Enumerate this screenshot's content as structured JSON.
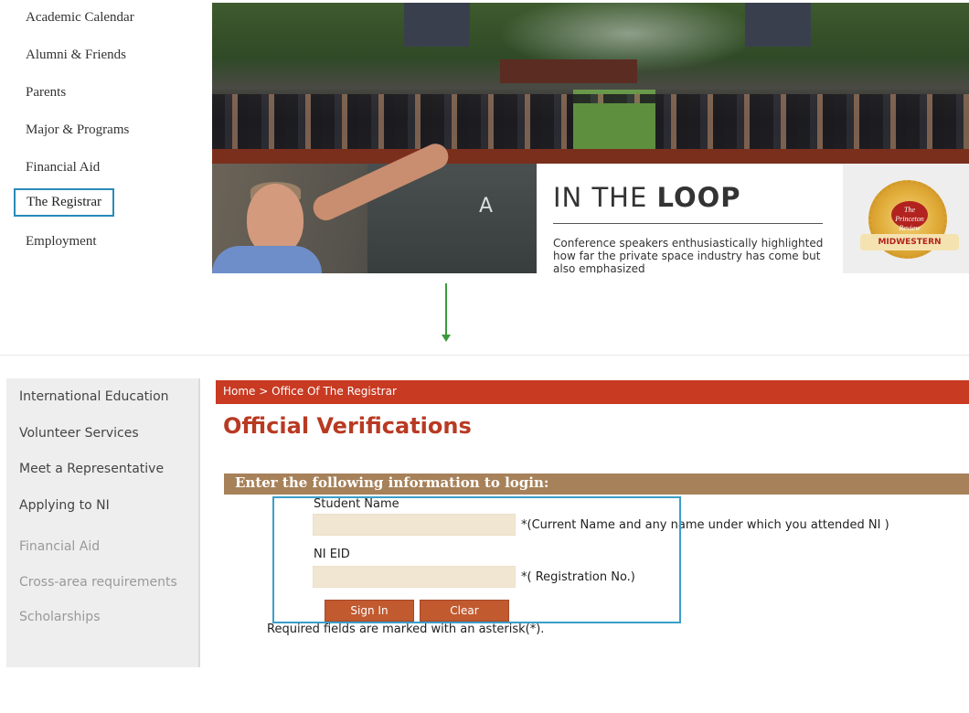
{
  "top": {
    "nav_items": [
      {
        "label": "Academic Calendar"
      },
      {
        "label": "Alumni & Friends"
      },
      {
        "label": "Parents"
      },
      {
        "label": "Major & Programs"
      },
      {
        "label": "Financial Aid"
      },
      {
        "label": "The Registrar",
        "selected": true
      },
      {
        "label": "Employment"
      }
    ],
    "loop": {
      "title_light": "IN THE ",
      "title_bold": "LOOP",
      "text": "Conference speakers enthusiastically highlighted how far the private space industry has come but also emphasized"
    },
    "badge": {
      "inner": "The Princeton Review",
      "ribbon": "MIDWESTERN"
    },
    "chalkboard_letter": "A"
  },
  "bottom": {
    "side_menu": [
      {
        "label": "International Education",
        "dim": false
      },
      {
        "label": "Volunteer Services",
        "dim": false
      },
      {
        "label": "Meet a Representative",
        "dim": false
      },
      {
        "label": "Applying to NI",
        "dim": false
      },
      {
        "label": "Financial Aid",
        "dim": true
      },
      {
        "label": "Cross-area requirements",
        "dim": true
      },
      {
        "label": "Scholarships",
        "dim": true
      }
    ],
    "breadcrumb": "Home > Office Of The Registrar",
    "page_title": "Official Verifications",
    "login_header": "Enter the following information to login:",
    "form": {
      "student_name_label": "Student Name",
      "student_name_value": "",
      "student_name_note": "*(Current Name and any name under which you attended NI )",
      "eid_label": "NI EID",
      "eid_value": "",
      "eid_note": "*( Registration No.)",
      "sign_in": "Sign In",
      "clear": "Clear"
    },
    "required_note": "Required fields are marked with an asterisk(*)."
  },
  "colors": {
    "accent_red": "#c83a22",
    "title_red": "#b83a22",
    "login_header_brown": "#a6815a",
    "button_orange": "#c25a30",
    "highlight_blue": "#3a9fc8",
    "arrow_green": "#3a9a3a"
  }
}
